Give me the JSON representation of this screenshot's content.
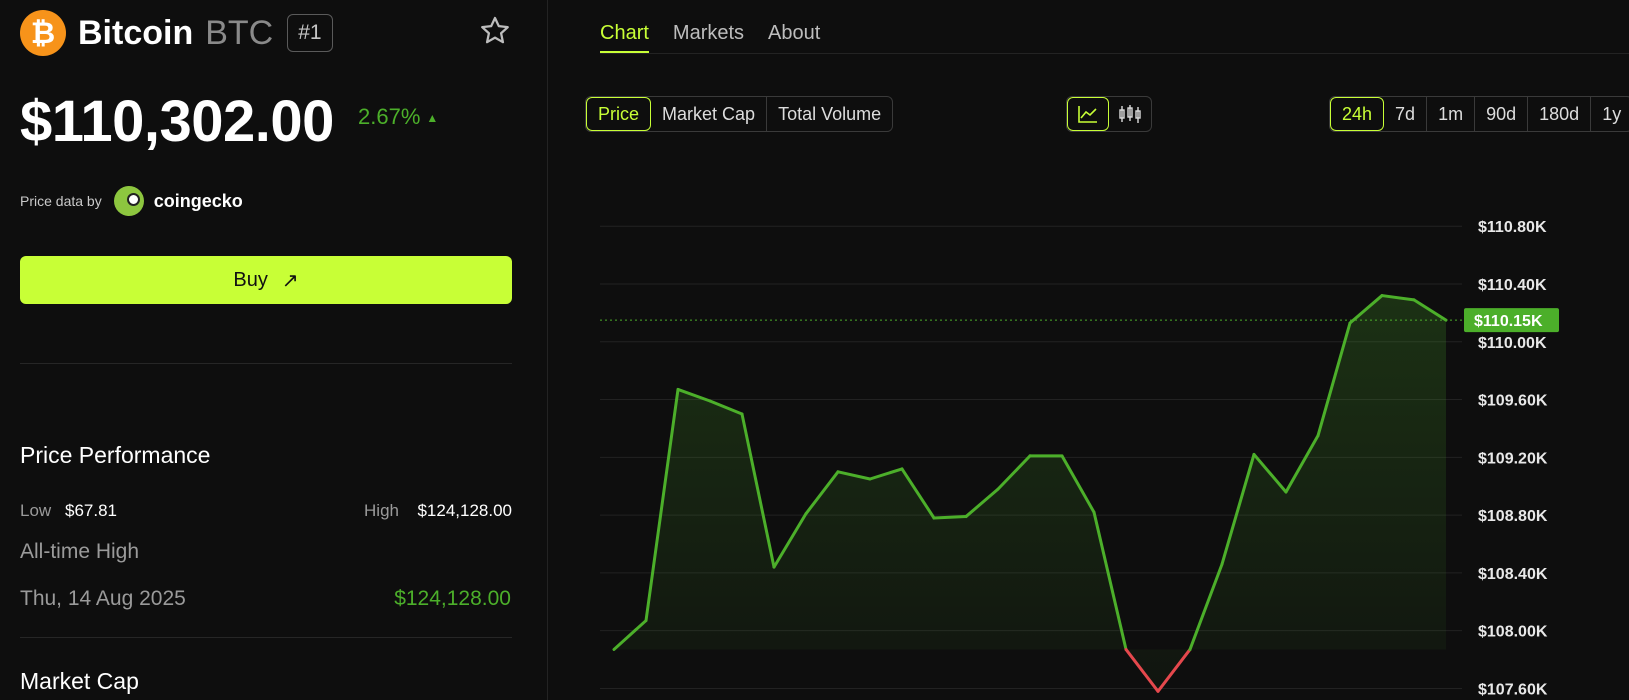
{
  "coin": {
    "name": "Bitcoin",
    "symbol": "BTC",
    "rank": "#1",
    "logo_glyph": "₿",
    "logo_color": "#f7931a",
    "price": "$110,302.00",
    "change": "2.67%",
    "change_arrow": "▲",
    "change_color": "#4caf2a",
    "favorite_icon": "star-icon"
  },
  "price_data": {
    "label": "Price data by",
    "provider": "coingecko"
  },
  "buy": {
    "label": "Buy",
    "icon": "↗",
    "color": "#c8ff36"
  },
  "performance": {
    "title": "Price Performance",
    "low_label": "Low",
    "low_value": "$67.81",
    "high_label": "High",
    "high_value": "$124,128.00",
    "ath_label": "All-time High",
    "ath_date": "Thu, 14 Aug 2025",
    "ath_value": "$124,128.00"
  },
  "market_cap": {
    "title": "Market Cap"
  },
  "tabs": [
    {
      "label": "Chart",
      "active": true
    },
    {
      "label": "Markets",
      "active": false
    },
    {
      "label": "About",
      "active": false
    }
  ],
  "metric_toggle": [
    {
      "label": "Price",
      "active": true
    },
    {
      "label": "Market Cap",
      "active": false
    },
    {
      "label": "Total Volume",
      "active": false
    }
  ],
  "chart_type_toggle": [
    {
      "icon": "line-chart-icon",
      "active": true
    },
    {
      "icon": "candlestick-icon",
      "active": false
    }
  ],
  "ranges": [
    {
      "label": "24h",
      "active": true
    },
    {
      "label": "7d",
      "active": false
    },
    {
      "label": "1m",
      "active": false
    },
    {
      "label": "90d",
      "active": false
    },
    {
      "label": "180d",
      "active": false
    },
    {
      "label": "1y",
      "active": false
    }
  ],
  "chart_data": {
    "type": "area",
    "y_ticks": [
      "$110.80K",
      "$110.40K",
      "$110.00K",
      "$109.60K",
      "$109.20K",
      "$108.80K",
      "$108.40K",
      "$108.00K",
      "$107.60K"
    ],
    "current_label": "$110.15K",
    "current_value": 110150,
    "baseline_value": 107870,
    "ylim": [
      107520,
      111120
    ],
    "grid": true,
    "up_color": "#4caf2a",
    "down_color": "#e5484d",
    "series": [
      {
        "values": [
          107870,
          108070,
          109670,
          109590,
          109500,
          108440,
          108810,
          109100,
          109050,
          109120,
          108780,
          108790,
          108980,
          109210,
          109210,
          108820,
          107870,
          107580,
          107870,
          108460,
          109220,
          108960,
          109350,
          110130,
          110320,
          110290,
          110150
        ]
      }
    ]
  }
}
